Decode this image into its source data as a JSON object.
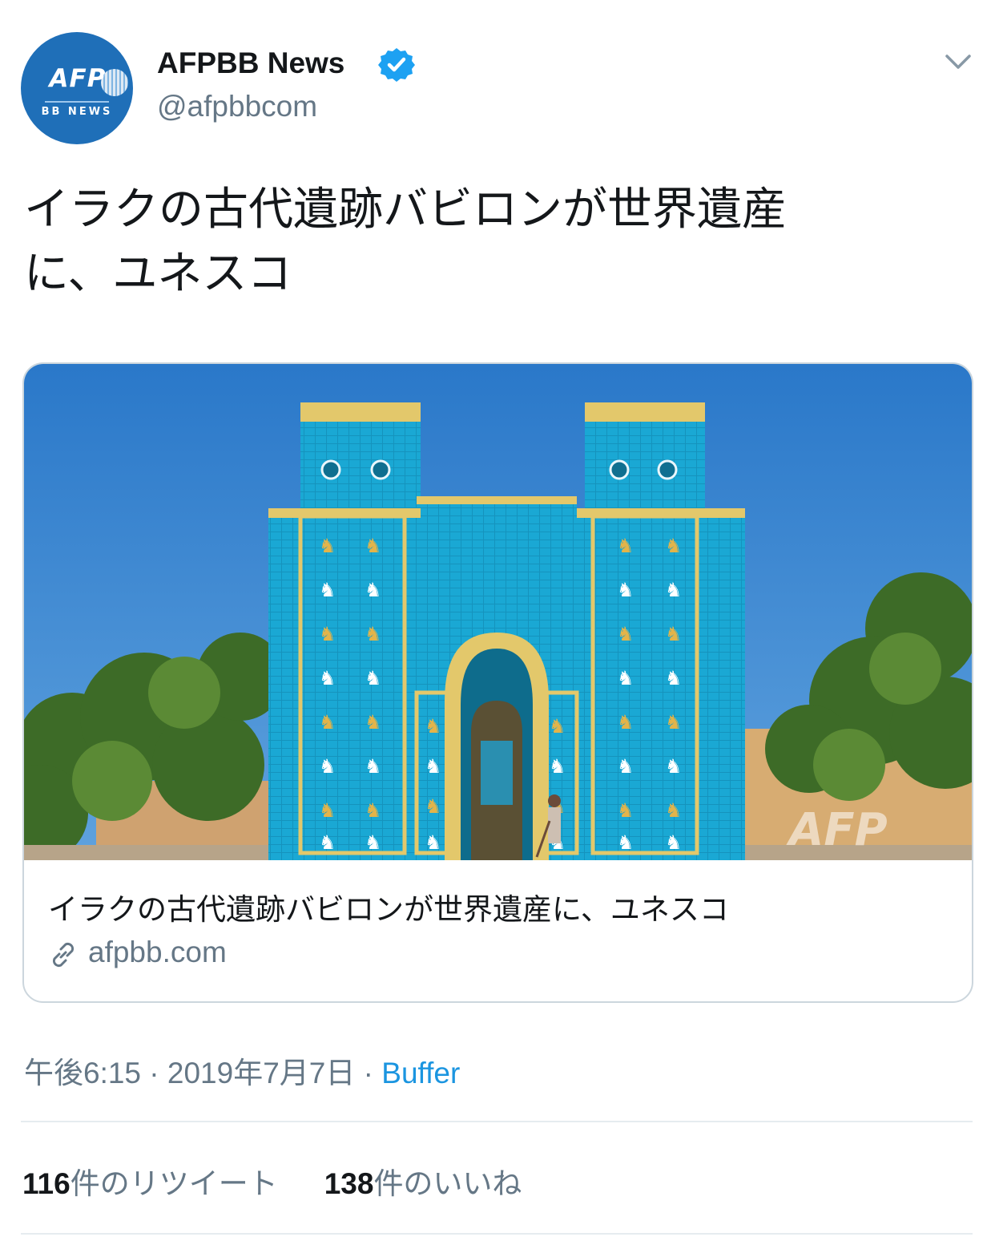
{
  "author": {
    "avatar_label": "AFP",
    "avatar_sub": "BB NEWS",
    "name": "AFPBB News",
    "handle": "@afpbbcom",
    "verified": true
  },
  "tweet": {
    "text_line1": "イラクの古代遺跡バビロンが世界遺産",
    "text_line2": "に、ユネスコ"
  },
  "card": {
    "image_watermark": "AFP",
    "title": "イラクの古代遺跡バビロンが世界遺産に、ユネスコ",
    "domain": "afpbb.com"
  },
  "meta": {
    "time": "午後6:15",
    "sep1": " · ",
    "date": "2019年7月7日",
    "sep2": " · ",
    "source": "Buffer"
  },
  "stats": {
    "retweets_count": "116",
    "retweets_label": "件のリツイート",
    "likes_count": "138",
    "likes_label": "件のいいね"
  },
  "icons": {
    "verified": "verified-badge-icon",
    "menu": "chevron-down-icon",
    "link": "link-icon"
  },
  "colors": {
    "verified": "#1da1f2",
    "link_source": "#1b95e0",
    "secondary_text": "#657786",
    "avatar_bg": "#1f6fb8",
    "gate_blue": "#1aa8d4",
    "sky": "#2f7fd0"
  }
}
